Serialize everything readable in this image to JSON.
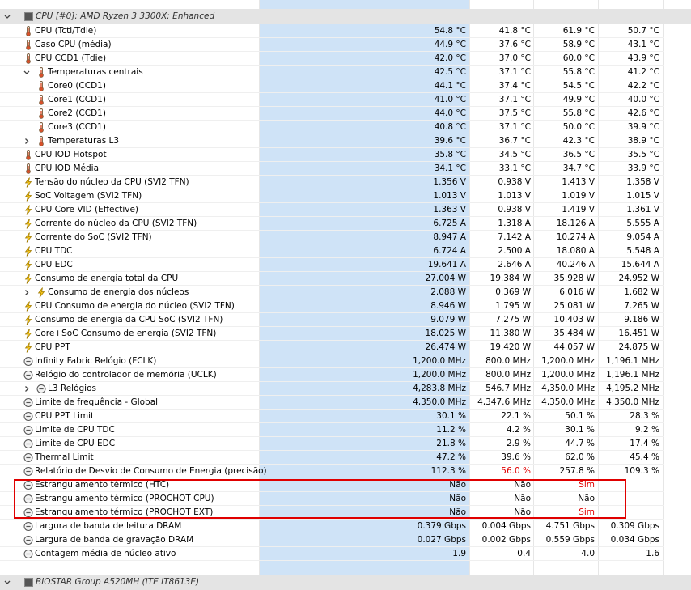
{
  "group_top": {
    "label": "CPU [#0]: AMD Ryzen 3 3300X: Enhanced"
  },
  "group_bottom": {
    "label": "BIOSTAR Group A520MH (ITE IT8613E)"
  },
  "colors": {
    "row_highlight": "#cfe3f7",
    "group_bg": "#e4e4e4",
    "alert_red": "#e00000",
    "annotation_box": "#e00000"
  },
  "rows": [
    {
      "label": "CPU (Tctl/Tdie)",
      "icon": "thermometer-icon",
      "indent": 0,
      "values": [
        "54.8 °C",
        "41.8 °C",
        "61.9 °C",
        "50.7 °C"
      ]
    },
    {
      "label": "Caso CPU (média)",
      "icon": "thermometer-icon",
      "indent": 0,
      "values": [
        "44.9 °C",
        "37.6 °C",
        "58.9 °C",
        "43.1 °C"
      ]
    },
    {
      "label": "CPU CCD1 (Tdie)",
      "icon": "thermometer-icon",
      "indent": 0,
      "values": [
        "42.0 °C",
        "37.0 °C",
        "60.0 °C",
        "43.9 °C"
      ]
    },
    {
      "label": "Temperaturas centrais",
      "icon": "thermometer-icon",
      "indent": 1,
      "chevron": "down",
      "values": [
        "42.5 °C",
        "37.1 °C",
        "55.8 °C",
        "41.2 °C"
      ]
    },
    {
      "label": "Core0 (CCD1)",
      "icon": "thermometer-icon",
      "indent": 2,
      "values": [
        "44.1 °C",
        "37.4 °C",
        "54.5 °C",
        "42.2 °C"
      ]
    },
    {
      "label": "Core1 (CCD1)",
      "icon": "thermometer-icon",
      "indent": 2,
      "values": [
        "41.0 °C",
        "37.1 °C",
        "49.9 °C",
        "40.0 °C"
      ]
    },
    {
      "label": "Core2 (CCD1)",
      "icon": "thermometer-icon",
      "indent": 2,
      "values": [
        "44.0 °C",
        "37.5 °C",
        "55.8 °C",
        "42.6 °C"
      ]
    },
    {
      "label": "Core3 (CCD1)",
      "icon": "thermometer-icon",
      "indent": 2,
      "values": [
        "40.8 °C",
        "37.1 °C",
        "50.0 °C",
        "39.9 °C"
      ]
    },
    {
      "label": "Temperaturas L3",
      "icon": "thermometer-icon",
      "indent": 1,
      "chevron": "right",
      "values": [
        "39.6 °C",
        "36.7 °C",
        "42.3 °C",
        "38.9 °C"
      ]
    },
    {
      "label": "CPU IOD Hotspot",
      "icon": "thermometer-icon",
      "indent": 0,
      "values": [
        "35.8 °C",
        "34.5 °C",
        "36.5 °C",
        "35.5 °C"
      ]
    },
    {
      "label": "CPU IOD Média",
      "icon": "thermometer-icon",
      "indent": 0,
      "values": [
        "34.1 °C",
        "33.1 °C",
        "34.7 °C",
        "33.9 °C"
      ]
    },
    {
      "label": "Tensão do núcleo da CPU (SVI2 TFN)",
      "icon": "lightning-icon",
      "indent": 0,
      "values": [
        "1.356 V",
        "0.938 V",
        "1.413 V",
        "1.358 V"
      ]
    },
    {
      "label": "SoC Voltagem (SVI2 TFN)",
      "icon": "lightning-icon",
      "indent": 0,
      "values": [
        "1.013 V",
        "1.013 V",
        "1.019 V",
        "1.015 V"
      ]
    },
    {
      "label": "CPU Core VID (Effective)",
      "icon": "lightning-icon",
      "indent": 0,
      "values": [
        "1.363 V",
        "0.938 V",
        "1.419 V",
        "1.361 V"
      ]
    },
    {
      "label": "Corrente do núcleo da CPU (SVI2 TFN)",
      "icon": "lightning-icon",
      "indent": 0,
      "values": [
        "6.725 A",
        "1.318 A",
        "18.126 A",
        "5.555 A"
      ]
    },
    {
      "label": "Corrente do SoC (SVI2 TFN)",
      "icon": "lightning-icon",
      "indent": 0,
      "values": [
        "8.947 A",
        "7.142 A",
        "10.274 A",
        "9.054 A"
      ]
    },
    {
      "label": "CPU TDC",
      "icon": "lightning-icon",
      "indent": 0,
      "values": [
        "6.724 A",
        "2.500 A",
        "18.080 A",
        "5.548 A"
      ]
    },
    {
      "label": "CPU EDC",
      "icon": "lightning-icon",
      "indent": 0,
      "values": [
        "19.641 A",
        "2.646 A",
        "40.246 A",
        "15.644 A"
      ]
    },
    {
      "label": "Consumo de energia total da CPU",
      "icon": "lightning-icon",
      "indent": 0,
      "values": [
        "27.004 W",
        "19.384 W",
        "35.928 W",
        "24.952 W"
      ]
    },
    {
      "label": "Consumo de energia dos núcleos",
      "icon": "lightning-icon",
      "indent": 1,
      "chevron": "right",
      "values": [
        "2.088 W",
        "0.369 W",
        "6.016 W",
        "1.682 W"
      ]
    },
    {
      "label": "CPU Consumo de energia do núcleo (SVI2 TFN)",
      "icon": "lightning-icon",
      "indent": 0,
      "values": [
        "8.946 W",
        "1.795 W",
        "25.081 W",
        "7.265 W"
      ]
    },
    {
      "label": "Consumo de energia da CPU SoC (SVI2 TFN)",
      "icon": "lightning-icon",
      "indent": 0,
      "values": [
        "9.079 W",
        "7.275 W",
        "10.403 W",
        "9.186 W"
      ]
    },
    {
      "label": "Core+SoC Consumo de energia (SVI2 TFN)",
      "icon": "lightning-icon",
      "indent": 0,
      "values": [
        "18.025 W",
        "11.380 W",
        "35.484 W",
        "16.451 W"
      ]
    },
    {
      "label": "CPU PPT",
      "icon": "lightning-icon",
      "indent": 0,
      "values": [
        "26.474 W",
        "19.420 W",
        "44.057 W",
        "24.875 W"
      ]
    },
    {
      "label": "Infinity Fabric Relógio (FCLK)",
      "icon": "clock-icon",
      "indent": 0,
      "values": [
        "1,200.0 MHz",
        "800.0 MHz",
        "1,200.0 MHz",
        "1,196.1 MHz"
      ]
    },
    {
      "label": "Relógio do controlador de memória (UCLK)",
      "icon": "clock-icon",
      "indent": 0,
      "values": [
        "1,200.0 MHz",
        "800.0 MHz",
        "1,200.0 MHz",
        "1,196.1 MHz"
      ]
    },
    {
      "label": "L3 Relógios",
      "icon": "clock-icon",
      "indent": 1,
      "chevron": "right",
      "values": [
        "4,283.8 MHz",
        "546.7 MHz",
        "4,350.0 MHz",
        "4,195.2 MHz"
      ]
    },
    {
      "label": "Limite de frequência - Global",
      "icon": "clock-icon",
      "indent": 0,
      "values": [
        "4,350.0 MHz",
        "4,347.6 MHz",
        "4,350.0 MHz",
        "4,350.0 MHz"
      ]
    },
    {
      "label": "CPU PPT Limit",
      "icon": "clock-icon",
      "indent": 0,
      "values": [
        "30.1 %",
        "22.1 %",
        "50.1 %",
        "28.3 %"
      ]
    },
    {
      "label": "Limite de CPU TDC",
      "icon": "clock-icon",
      "indent": 0,
      "values": [
        "11.2 %",
        "4.2 %",
        "30.1 %",
        "9.2 %"
      ]
    },
    {
      "label": "Limite de CPU EDC",
      "icon": "clock-icon",
      "indent": 0,
      "values": [
        "21.8 %",
        "2.9 %",
        "44.7 %",
        "17.4 %"
      ]
    },
    {
      "label": "Thermal Limit",
      "icon": "clock-icon",
      "indent": 0,
      "values": [
        "47.2 %",
        "39.6 %",
        "62.0 %",
        "45.4 %"
      ]
    },
    {
      "label": "Relatório de Desvio de Consumo de Energia (precisão)",
      "icon": "clock-icon",
      "indent": 0,
      "values": [
        "112.3 %",
        "56.0 %",
        "257.8 %",
        "109.3 %"
      ],
      "red": [
        1
      ]
    },
    {
      "label": "Estrangulamento térmico (HTC)",
      "icon": "clock-icon",
      "indent": 0,
      "values": [
        "Não",
        "Não",
        "Sim",
        ""
      ],
      "red": [
        2
      ]
    },
    {
      "label": "Estrangulamento térmico (PROCHOT CPU)",
      "icon": "clock-icon",
      "indent": 0,
      "values": [
        "Não",
        "Não",
        "Não",
        ""
      ]
    },
    {
      "label": "Estrangulamento térmico (PROCHOT EXT)",
      "icon": "clock-icon",
      "indent": 0,
      "values": [
        "Não",
        "Não",
        "Sim",
        ""
      ],
      "red": [
        2
      ]
    },
    {
      "label": "Largura de banda de leitura DRAM",
      "icon": "clock-icon",
      "indent": 0,
      "values": [
        "0.379 Gbps",
        "0.004 Gbps",
        "4.751 Gbps",
        "0.309 Gbps"
      ]
    },
    {
      "label": "Largura de banda de gravação DRAM",
      "icon": "clock-icon",
      "indent": 0,
      "values": [
        "0.027 Gbps",
        "0.002 Gbps",
        "0.559 Gbps",
        "0.034 Gbps"
      ]
    },
    {
      "label": "Contagem média de núcleo ativo",
      "icon": "clock-icon",
      "indent": 0,
      "values": [
        "1.9",
        "0.4",
        "4.0",
        "1.6"
      ]
    }
  ]
}
